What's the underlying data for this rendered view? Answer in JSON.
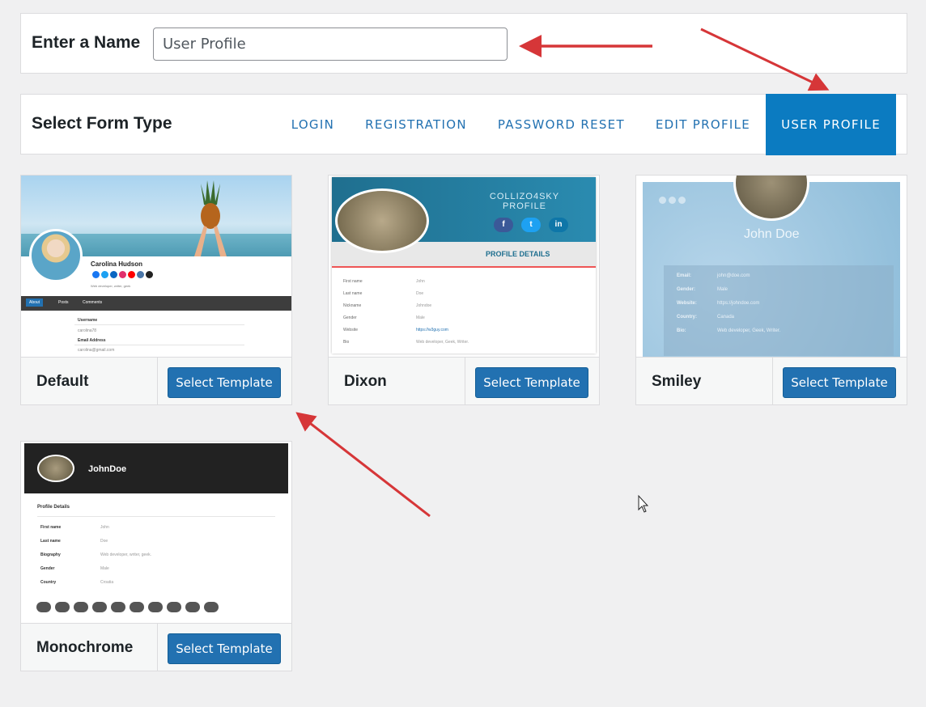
{
  "name_panel": {
    "label": "Enter a Name",
    "value": "User Profile"
  },
  "type_panel": {
    "label": "Select Form Type",
    "tabs": [
      {
        "label": "LOGIN"
      },
      {
        "label": "REGISTRATION"
      },
      {
        "label": "PASSWORD RESET"
      },
      {
        "label": "EDIT PROFILE"
      },
      {
        "label": "USER PROFILE",
        "active": true
      }
    ]
  },
  "templates": [
    {
      "name": "Default",
      "button": "Select Template",
      "preview": {
        "user": "Carolina Hudson",
        "bio": "Web developer, writer, geek",
        "tabs": [
          "About",
          "Posts",
          "Comments"
        ],
        "fields": [
          "Username",
          "carolina78",
          "Email Address",
          "carolina@gmail.com"
        ]
      }
    },
    {
      "name": "Dixon",
      "button": "Select Template",
      "preview": {
        "title_line1": "COLLIZO4SKY",
        "title_line2": "PROFILE",
        "social": [
          "f",
          "t",
          "in"
        ],
        "section": "PROFILE DETAILS",
        "rows": [
          {
            "k": "First name",
            "v": "John"
          },
          {
            "k": "Last name",
            "v": "Doe"
          },
          {
            "k": "Nickname",
            "v": "Johndoe"
          },
          {
            "k": "Gender",
            "v": "Male"
          },
          {
            "k": "Website",
            "v": "https://w3guy.com"
          },
          {
            "k": "Bio",
            "v": "Web developer, Geek, Writer."
          }
        ]
      }
    },
    {
      "name": "Smiley",
      "button": "Select Template",
      "preview": {
        "user": "John Doe",
        "rows": [
          {
            "k": "Email:",
            "v": "john@doe.com"
          },
          {
            "k": "Gender:",
            "v": "Male"
          },
          {
            "k": "Website:",
            "v": "https://johndoe.com"
          },
          {
            "k": "Country:",
            "v": "Canada"
          },
          {
            "k": "Bio:",
            "v": "Web developer, Geek, Writer."
          }
        ]
      }
    },
    {
      "name": "Monochrome",
      "button": "Select Template",
      "preview": {
        "user": "JohnDoe",
        "section": "Profile Details",
        "rows": [
          {
            "k": "First name",
            "v": "John"
          },
          {
            "k": "Last name",
            "v": "Doe"
          },
          {
            "k": "Biography",
            "v": "Web developer, writer, geek."
          },
          {
            "k": "Gender",
            "v": "Male"
          },
          {
            "k": "Country",
            "v": "Croatia"
          }
        ]
      }
    }
  ],
  "colors": {
    "accent": "#2271b1",
    "active_tab": "#0b7bc1",
    "arrow": "#d63638"
  }
}
